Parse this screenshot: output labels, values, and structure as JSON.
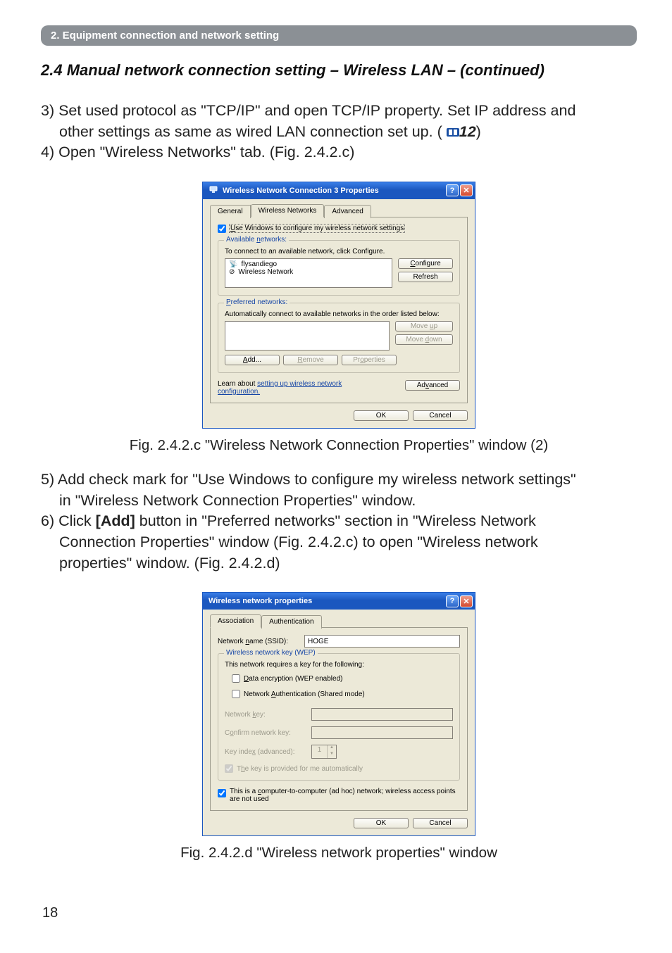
{
  "section_bar": "2. Equipment connection and network setting",
  "heading": "2.4 Manual network connection setting – Wireless LAN – (continued)",
  "para1": {
    "l1a": "3) Set used protocol as \"TCP/IP\" and open TCP/IP property. Set IP address and",
    "l1b": "other settings as same as wired LAN connection set up. (",
    "ref": "12",
    "l1c": ")",
    "l2": "4) Open \"Wireless Networks\" tab. (Fig. 2.4.2.c)"
  },
  "dialog1": {
    "title": "Wireless Network Connection 3 Properties",
    "tabs": {
      "general": "General",
      "wireless": "Wireless Networks",
      "advanced": "Advanced"
    },
    "use_windows_html": "<u class='k'>U</u>se Windows to configure my wireless network settings",
    "avail_legend_html": "Available <u class='k'>n</u>etworks:",
    "avail_desc": "To connect to an available network, click Configure.",
    "avail_items": {
      "a": "flysandiego",
      "b": "Wireless Network"
    },
    "btn_configure_html": "<u class='k'>C</u>onfigure",
    "btn_refresh": "Refresh",
    "pref_legend_html": "<u class='k'>P</u>referred networks:",
    "pref_desc": "Automatically connect to available networks in the order listed below:",
    "btn_moveup_html": "Move <u class='k'>u</u>p",
    "btn_movedown_html": "Move <u class='k'>d</u>own",
    "btn_add_html": "<u class='k'>A</u>dd...",
    "btn_remove_html": "<u class='k'>R</u>emove",
    "btn_props_html": "Pr<u class='k'>o</u>perties",
    "learn_text": "Learn about ",
    "learn_link": "setting up wireless network configuration.",
    "btn_advanced_html": "Ad<u class='k'>v</u>anced",
    "btn_ok": "OK",
    "btn_cancel": "Cancel"
  },
  "caption1": "Fig. 2.4.2.c \"Wireless Network Connection Properties\" window (2)",
  "para2": {
    "l1a": "5) Add check mark for \"Use Windows to configure my wireless network settings\"",
    "l1b": "in \"Wireless Network Connection Properties\" window.",
    "l2a": "6) Click ",
    "l2bold": "[Add]",
    "l2b": " button in \"Preferred networks\" section in \"Wireless Network",
    "l2c": "Connection Properties\" window (Fig. 2.4.2.c) to open \"Wireless network",
    "l2d": "properties\" window. (Fig. 2.4.2.d)"
  },
  "dialog2": {
    "title": "Wireless network properties",
    "tabs": {
      "assoc": "Association",
      "auth": "Authentication"
    },
    "ssid_label_html": "Network <u class='k'>n</u>ame (SSID):",
    "ssid_value": "HOGE",
    "wep_legend": "Wireless network key (WEP)",
    "wep_desc": "This network requires a key for the following:",
    "chk_data_html": "<u class='k'>D</u>ata encryption (WEP enabled)",
    "chk_auth_html": "Network <u class='k'>A</u>uthentication (Shared mode)",
    "key_label_html": "Network <u class='k'>k</u>ey:",
    "confirm_label_html": "C<u class='k'>o</u>nfirm network key:",
    "keyidx_label_html": "Key inde<u class='k'>x</u> (advanced):",
    "keyidx_value": "1",
    "chk_provided_html": "T<u class='k'>h</u>e key is provided for me automatically",
    "chk_adhoc_html": "This is a <u class='k'>c</u>omputer-to-computer (ad hoc) network; wireless access points are not used",
    "btn_ok": "OK",
    "btn_cancel": "Cancel"
  },
  "caption2": "Fig. 2.4.2.d \"Wireless network properties\" window",
  "page_number": "18"
}
